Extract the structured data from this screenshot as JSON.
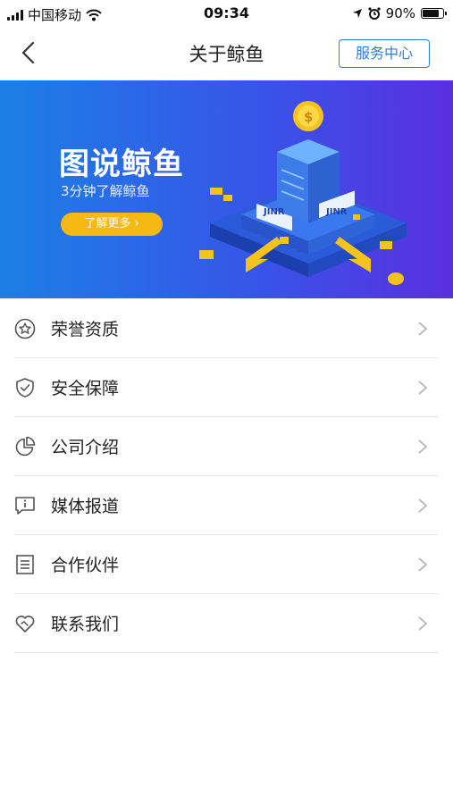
{
  "status_bar": {
    "carrier": "中国移动",
    "time": "09:34",
    "battery": "90%",
    "battery_level": 0.9,
    "icons": [
      "signal-icon",
      "wifi-icon",
      "location-icon",
      "alarm-icon",
      "battery-icon"
    ]
  },
  "nav": {
    "title": "关于鲸鱼",
    "service_label": "服务中心",
    "back_icon": "back-chevron-icon",
    "accent_color": "#2f7fd9"
  },
  "banner": {
    "title": "图说鲸鱼",
    "subtitle": "3分钟了解鲸鱼",
    "button_label": "了解更多 ›",
    "art_label_1": "JINR",
    "art_label_2": "JINR",
    "coin_symbol": "$",
    "button_color": "#f6b913"
  },
  "menu": {
    "items": [
      {
        "label": "荣誉资质",
        "icon": "star-badge-icon"
      },
      {
        "label": "安全保障",
        "icon": "shield-check-icon"
      },
      {
        "label": "公司介绍",
        "icon": "pie-chart-icon"
      },
      {
        "label": "媒体报道",
        "icon": "info-bubble-icon"
      },
      {
        "label": "合作伙伴",
        "icon": "document-list-icon"
      },
      {
        "label": "联系我们",
        "icon": "heart-handshake-icon"
      }
    ]
  }
}
